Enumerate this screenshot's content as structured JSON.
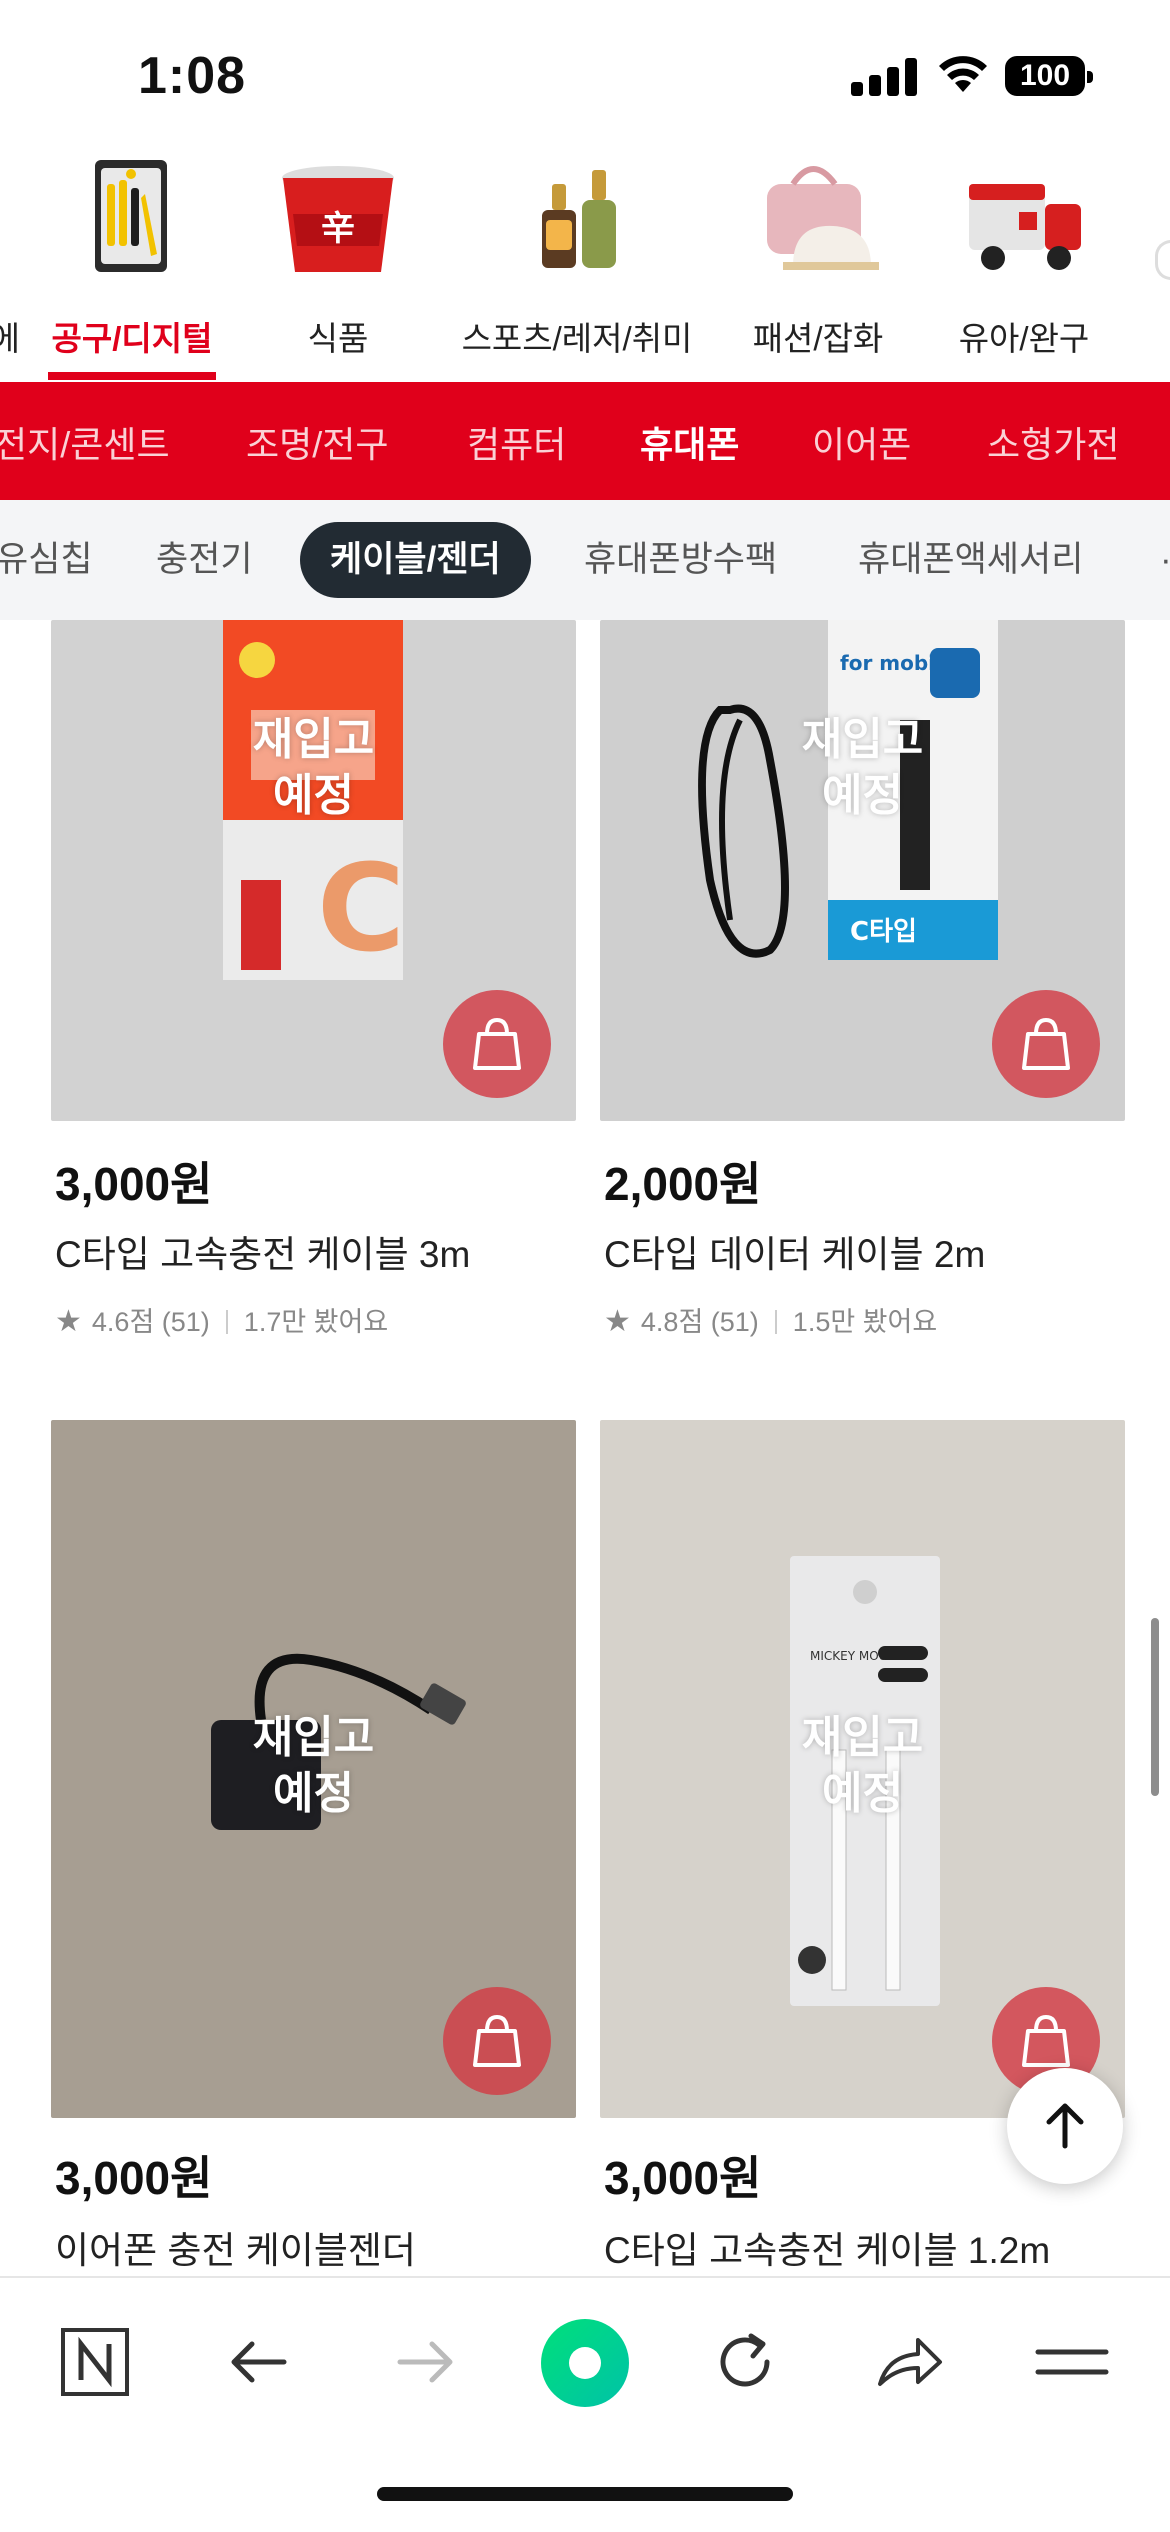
{
  "status_bar": {
    "time": "1:08",
    "battery": "100"
  },
  "categories": [
    {
      "label": "에",
      "icon": "previous-category-icon"
    },
    {
      "label": "공구/디지털",
      "icon": "tools-icon",
      "active": true
    },
    {
      "label": "식품",
      "icon": "ramen-icon"
    },
    {
      "label": "스포츠/레저/취미",
      "icon": "camping-lantern-icon"
    },
    {
      "label": "패션/잡화",
      "icon": "bag-hat-icon"
    },
    {
      "label": "유아/완구",
      "icon": "toy-truck-icon"
    },
    {
      "label": "",
      "icon": "next-category-icon"
    }
  ],
  "sub_nav": {
    "tabs": [
      "전지/콘센트",
      "조명/전구",
      "컴퓨터",
      "휴대폰",
      "이어폰",
      "소형가전"
    ],
    "active": "휴대폰",
    "colors": {
      "bar": "#e0001b"
    }
  },
  "chips": {
    "items": [
      "유심칩",
      "충전기",
      "케이블/젠더",
      "휴대폰방수팩",
      "휴대폰액세서리"
    ],
    "active": "케이블/젠더"
  },
  "products": [
    {
      "price": "3,000원",
      "name": "C타입 고속충전 케이블 3m",
      "overlay": "재입고\n예정",
      "overlay_line1": "재입고",
      "overlay_line2": "예정",
      "rating": "4.6점 (51)",
      "views": "1.7만 봤어요",
      "image": "cable-orange-package"
    },
    {
      "price": "2,000원",
      "name": "C타입 데이터 케이블 2m",
      "overlay_line1": "재입고",
      "overlay_line2": "예정",
      "rating": "4.8점 (51)",
      "views": "1.5만 봤어요",
      "image": "cable-blue-package",
      "package_text": "for mobile",
      "package_badge": "C타입"
    },
    {
      "price": "3,000원",
      "name": "이어폰 충전 케이블젠더",
      "overlay_line1": "재입고",
      "overlay_line2": "예정",
      "image": "earphone-gender-adapter"
    },
    {
      "price": "3,000원",
      "name": "C타입 고속충전 케이블 1.2m",
      "overlay_line1": "재입고",
      "overlay_line2": "예정",
      "image": "mickey-cable-package",
      "package_text": "MICKEY MOUSE"
    }
  ],
  "bottom_bar": {
    "items": [
      "naver-n-icon",
      "back-arrow-icon",
      "forward-arrow-icon",
      "green-home-icon",
      "refresh-icon",
      "share-icon",
      "menu-icon"
    ]
  },
  "colors": {
    "accent": "#e0001b",
    "chip_active": "#222b33",
    "cart_button": "#d23c46"
  }
}
